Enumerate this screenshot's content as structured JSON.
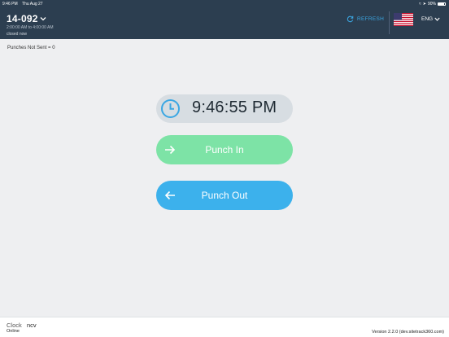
{
  "status_bar": {
    "time": "9:46 PM",
    "date": "Thu Aug 27",
    "battery": "90%"
  },
  "header": {
    "site_id": "14-092",
    "hours": "2:00:00 AM to 4:00:00 AM",
    "status": "closed now",
    "refresh_label": "REFRESH",
    "language": "ENG"
  },
  "punches_not_sent": "Punches Not Sent = 0",
  "clock": {
    "time": "9:46:55 PM"
  },
  "buttons": {
    "punch_in": "Punch In",
    "punch_out": "Punch Out"
  },
  "footer": {
    "clock_label": "Clock",
    "clock_name": "ncv",
    "connection": "Online",
    "version": "Version 2.2.0 (dev.sitetrack360.com)"
  },
  "colors": {
    "header_bg": "#2c3e50",
    "accent_blue": "#3ba7e3",
    "punch_in": "#7de3a6",
    "punch_out": "#3cb1ec",
    "clock_pill": "#d7dde2",
    "background": "#eeeff1"
  },
  "icons": {
    "refresh": "refresh-icon",
    "flag": "us-flag-icon",
    "clock": "clock-icon",
    "punch_in": "arrow-right-icon",
    "punch_out": "arrow-left-icon"
  }
}
